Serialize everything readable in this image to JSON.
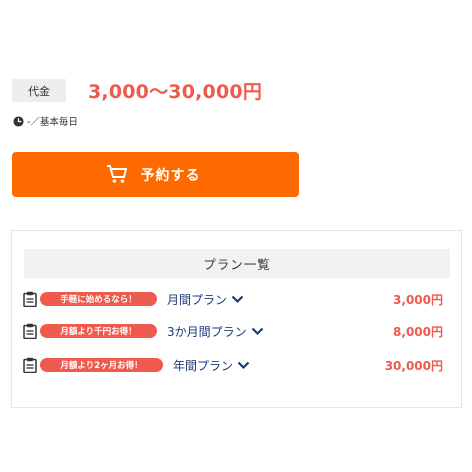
{
  "price": {
    "label": "代金",
    "value": "3,000〜30,000円"
  },
  "schedule": {
    "text": "-／基本毎日"
  },
  "reserve_button": {
    "label": "予約する"
  },
  "plans": {
    "title": "プラン一覧",
    "items": [
      {
        "badge": "手軽に始めるなら！",
        "name": "月間プラン",
        "price": "3,000円"
      },
      {
        "badge": "月額より千円お得！",
        "name": "3か月間プラン",
        "price": "8,000円"
      },
      {
        "badge": "月額より2ヶ月お得！",
        "name": "年間プラン",
        "price": "30,000円"
      }
    ]
  },
  "colors": {
    "accent_orange": "#ff6a00",
    "price_red": "#ef5a4f",
    "link_blue": "#1c3a7a"
  }
}
